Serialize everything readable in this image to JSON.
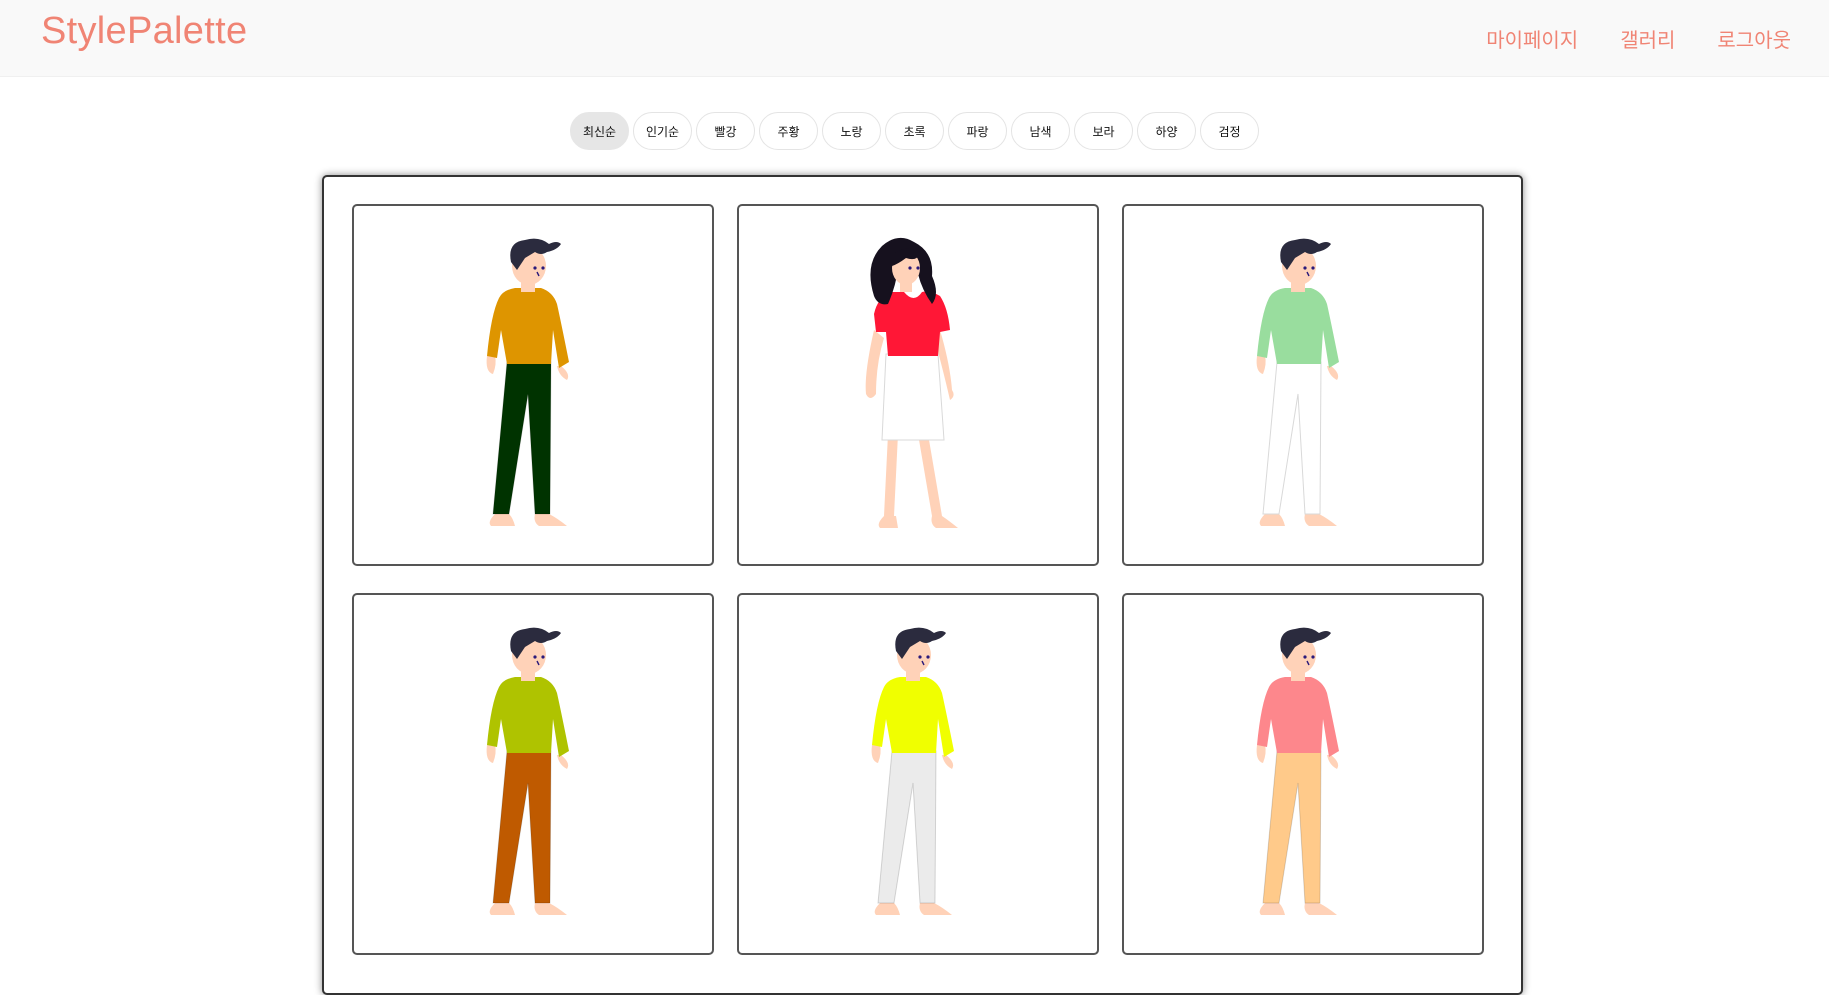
{
  "header": {
    "brand": "StylePalette",
    "nav": [
      "마이페이지",
      "갤러리",
      "로그아웃"
    ]
  },
  "filters": [
    {
      "label": "최신순",
      "active": true
    },
    {
      "label": "인기순"
    },
    {
      "label": "빨강"
    },
    {
      "label": "주황"
    },
    {
      "label": "노랑"
    },
    {
      "label": "초록"
    },
    {
      "label": "파랑"
    },
    {
      "label": "남색"
    },
    {
      "label": "보라"
    },
    {
      "label": "하양"
    },
    {
      "label": "검정"
    }
  ],
  "colors": {
    "accent": "#f08474",
    "skin": "#ffd2b8",
    "hair": "#2b2b3e"
  },
  "outfits": [
    {
      "figure": "male",
      "top": "#de9500",
      "bottom": "#003300"
    },
    {
      "figure": "female",
      "top": "#ff1736",
      "bottom": "#ffffff"
    },
    {
      "figure": "male",
      "top": "#99dd9e",
      "bottom": "#ffffff"
    },
    {
      "figure": "male",
      "top": "#afc300",
      "bottom": "#bf5a00"
    },
    {
      "figure": "male",
      "top": "#f0ff00",
      "bottom": "#ebebeb"
    },
    {
      "figure": "male",
      "top": "#fd878c",
      "bottom": "#ffca8a"
    }
  ]
}
